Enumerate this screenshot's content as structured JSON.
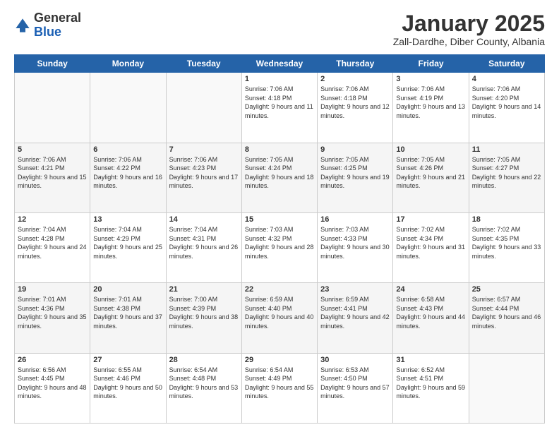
{
  "logo": {
    "general": "General",
    "blue": "Blue"
  },
  "header": {
    "month": "January 2025",
    "location": "Zall-Dardhe, Diber County, Albania"
  },
  "weekdays": [
    "Sunday",
    "Monday",
    "Tuesday",
    "Wednesday",
    "Thursday",
    "Friday",
    "Saturday"
  ],
  "weeks": [
    [
      {
        "day": "",
        "sunrise": "",
        "sunset": "",
        "daylight": ""
      },
      {
        "day": "",
        "sunrise": "",
        "sunset": "",
        "daylight": ""
      },
      {
        "day": "",
        "sunrise": "",
        "sunset": "",
        "daylight": ""
      },
      {
        "day": "1",
        "sunrise": "Sunrise: 7:06 AM",
        "sunset": "Sunset: 4:18 PM",
        "daylight": "Daylight: 9 hours and 11 minutes."
      },
      {
        "day": "2",
        "sunrise": "Sunrise: 7:06 AM",
        "sunset": "Sunset: 4:18 PM",
        "daylight": "Daylight: 9 hours and 12 minutes."
      },
      {
        "day": "3",
        "sunrise": "Sunrise: 7:06 AM",
        "sunset": "Sunset: 4:19 PM",
        "daylight": "Daylight: 9 hours and 13 minutes."
      },
      {
        "day": "4",
        "sunrise": "Sunrise: 7:06 AM",
        "sunset": "Sunset: 4:20 PM",
        "daylight": "Daylight: 9 hours and 14 minutes."
      }
    ],
    [
      {
        "day": "5",
        "sunrise": "Sunrise: 7:06 AM",
        "sunset": "Sunset: 4:21 PM",
        "daylight": "Daylight: 9 hours and 15 minutes."
      },
      {
        "day": "6",
        "sunrise": "Sunrise: 7:06 AM",
        "sunset": "Sunset: 4:22 PM",
        "daylight": "Daylight: 9 hours and 16 minutes."
      },
      {
        "day": "7",
        "sunrise": "Sunrise: 7:06 AM",
        "sunset": "Sunset: 4:23 PM",
        "daylight": "Daylight: 9 hours and 17 minutes."
      },
      {
        "day": "8",
        "sunrise": "Sunrise: 7:05 AM",
        "sunset": "Sunset: 4:24 PM",
        "daylight": "Daylight: 9 hours and 18 minutes."
      },
      {
        "day": "9",
        "sunrise": "Sunrise: 7:05 AM",
        "sunset": "Sunset: 4:25 PM",
        "daylight": "Daylight: 9 hours and 19 minutes."
      },
      {
        "day": "10",
        "sunrise": "Sunrise: 7:05 AM",
        "sunset": "Sunset: 4:26 PM",
        "daylight": "Daylight: 9 hours and 21 minutes."
      },
      {
        "day": "11",
        "sunrise": "Sunrise: 7:05 AM",
        "sunset": "Sunset: 4:27 PM",
        "daylight": "Daylight: 9 hours and 22 minutes."
      }
    ],
    [
      {
        "day": "12",
        "sunrise": "Sunrise: 7:04 AM",
        "sunset": "Sunset: 4:28 PM",
        "daylight": "Daylight: 9 hours and 24 minutes."
      },
      {
        "day": "13",
        "sunrise": "Sunrise: 7:04 AM",
        "sunset": "Sunset: 4:29 PM",
        "daylight": "Daylight: 9 hours and 25 minutes."
      },
      {
        "day": "14",
        "sunrise": "Sunrise: 7:04 AM",
        "sunset": "Sunset: 4:31 PM",
        "daylight": "Daylight: 9 hours and 26 minutes."
      },
      {
        "day": "15",
        "sunrise": "Sunrise: 7:03 AM",
        "sunset": "Sunset: 4:32 PM",
        "daylight": "Daylight: 9 hours and 28 minutes."
      },
      {
        "day": "16",
        "sunrise": "Sunrise: 7:03 AM",
        "sunset": "Sunset: 4:33 PM",
        "daylight": "Daylight: 9 hours and 30 minutes."
      },
      {
        "day": "17",
        "sunrise": "Sunrise: 7:02 AM",
        "sunset": "Sunset: 4:34 PM",
        "daylight": "Daylight: 9 hours and 31 minutes."
      },
      {
        "day": "18",
        "sunrise": "Sunrise: 7:02 AM",
        "sunset": "Sunset: 4:35 PM",
        "daylight": "Daylight: 9 hours and 33 minutes."
      }
    ],
    [
      {
        "day": "19",
        "sunrise": "Sunrise: 7:01 AM",
        "sunset": "Sunset: 4:36 PM",
        "daylight": "Daylight: 9 hours and 35 minutes."
      },
      {
        "day": "20",
        "sunrise": "Sunrise: 7:01 AM",
        "sunset": "Sunset: 4:38 PM",
        "daylight": "Daylight: 9 hours and 37 minutes."
      },
      {
        "day": "21",
        "sunrise": "Sunrise: 7:00 AM",
        "sunset": "Sunset: 4:39 PM",
        "daylight": "Daylight: 9 hours and 38 minutes."
      },
      {
        "day": "22",
        "sunrise": "Sunrise: 6:59 AM",
        "sunset": "Sunset: 4:40 PM",
        "daylight": "Daylight: 9 hours and 40 minutes."
      },
      {
        "day": "23",
        "sunrise": "Sunrise: 6:59 AM",
        "sunset": "Sunset: 4:41 PM",
        "daylight": "Daylight: 9 hours and 42 minutes."
      },
      {
        "day": "24",
        "sunrise": "Sunrise: 6:58 AM",
        "sunset": "Sunset: 4:43 PM",
        "daylight": "Daylight: 9 hours and 44 minutes."
      },
      {
        "day": "25",
        "sunrise": "Sunrise: 6:57 AM",
        "sunset": "Sunset: 4:44 PM",
        "daylight": "Daylight: 9 hours and 46 minutes."
      }
    ],
    [
      {
        "day": "26",
        "sunrise": "Sunrise: 6:56 AM",
        "sunset": "Sunset: 4:45 PM",
        "daylight": "Daylight: 9 hours and 48 minutes."
      },
      {
        "day": "27",
        "sunrise": "Sunrise: 6:55 AM",
        "sunset": "Sunset: 4:46 PM",
        "daylight": "Daylight: 9 hours and 50 minutes."
      },
      {
        "day": "28",
        "sunrise": "Sunrise: 6:54 AM",
        "sunset": "Sunset: 4:48 PM",
        "daylight": "Daylight: 9 hours and 53 minutes."
      },
      {
        "day": "29",
        "sunrise": "Sunrise: 6:54 AM",
        "sunset": "Sunset: 4:49 PM",
        "daylight": "Daylight: 9 hours and 55 minutes."
      },
      {
        "day": "30",
        "sunrise": "Sunrise: 6:53 AM",
        "sunset": "Sunset: 4:50 PM",
        "daylight": "Daylight: 9 hours and 57 minutes."
      },
      {
        "day": "31",
        "sunrise": "Sunrise: 6:52 AM",
        "sunset": "Sunset: 4:51 PM",
        "daylight": "Daylight: 9 hours and 59 minutes."
      },
      {
        "day": "",
        "sunrise": "",
        "sunset": "",
        "daylight": ""
      }
    ]
  ]
}
